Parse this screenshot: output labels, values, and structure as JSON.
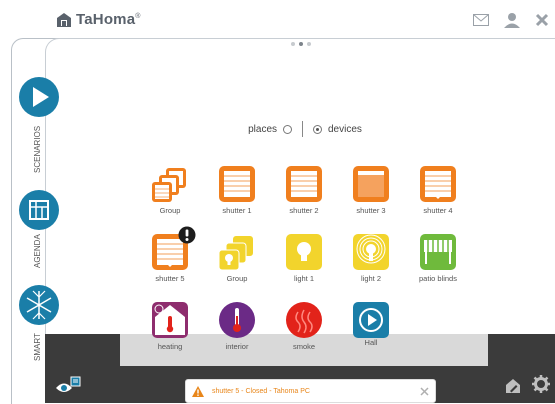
{
  "app": {
    "logo_text": "TaHoma",
    "logo_mark": "®"
  },
  "toolbar": {
    "icons": [
      "mail-icon",
      "user-icon",
      "close-icon"
    ]
  },
  "pager": {
    "pages": 3,
    "active": 2
  },
  "view_switch": {
    "places_label": "places",
    "devices_label": "devices",
    "selected": "devices"
  },
  "sidebar": {
    "scenarios_label": "SCENARIOS",
    "agenda_label": "AGENDA",
    "smart_label": "SMART"
  },
  "devices": [
    {
      "label": "Group",
      "icon": "shutter-group-icon"
    },
    {
      "label": "shutter 1",
      "icon": "shutter-icon"
    },
    {
      "label": "shutter 2",
      "icon": "shutter-icon"
    },
    {
      "label": "shutter 3",
      "icon": "shutter-closed-icon"
    },
    {
      "label": "shutter 4",
      "icon": "shutter-down-icon"
    },
    {
      "label": "shutter 5",
      "icon": "shutter-alert-icon"
    },
    {
      "label": "Group",
      "icon": "light-group-icon"
    },
    {
      "label": "light 1",
      "icon": "light-icon"
    },
    {
      "label": "light 2",
      "icon": "light-on-icon"
    },
    {
      "label": "patio blinds",
      "icon": "awning-icon"
    },
    {
      "label": "heating",
      "icon": "heating-icon"
    },
    {
      "label": "interior",
      "icon": "thermometer-icon"
    },
    {
      "label": "smoke",
      "icon": "smoke-icon"
    },
    {
      "label": "Hall",
      "icon": "play-icon"
    }
  ],
  "notification": {
    "text": "shutter 5 - Closed - Tahoma PC"
  },
  "colors": {
    "orange": "#f07f1e",
    "yellow": "#f2d42c",
    "green": "#6fba3c",
    "purple": "#7b2d8e",
    "red": "#e2231a",
    "blue": "#1a7ea8",
    "dark": "#3b3b3b"
  }
}
